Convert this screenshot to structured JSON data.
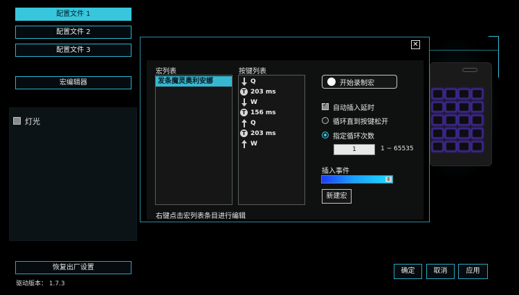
{
  "profiles": [
    {
      "label": "配置文件 1",
      "active": true
    },
    {
      "label": "配置文件 2",
      "active": false
    },
    {
      "label": "配置文件 3",
      "active": false
    }
  ],
  "macro_editor_label": "宏编辑器",
  "lighting": {
    "label": "灯光",
    "checked": false
  },
  "reset_label": "恢复出厂设置",
  "driver_version_label": "驱动版本： 1.7.3",
  "footer_buttons": {
    "ok": "确定",
    "cancel": "取消",
    "apply": "应用"
  },
  "dialog": {
    "macro_list_label": "宏列表",
    "macros": [
      "发条魔灵奥利安娜"
    ],
    "key_list_label": "按键列表",
    "key_events": [
      {
        "type": "down",
        "text": "Q"
      },
      {
        "type": "delay",
        "text": "203 ms"
      },
      {
        "type": "down",
        "text": "W"
      },
      {
        "type": "delay",
        "text": "156 ms"
      },
      {
        "type": "up",
        "text": "Q"
      },
      {
        "type": "delay",
        "text": "203 ms"
      },
      {
        "type": "up",
        "text": "W"
      }
    ],
    "record_label": "开始录制宏",
    "auto_delay_label": "自动插入延时",
    "auto_delay_checked": true,
    "loop_until_release_label": "循环直到按键松开",
    "loop_count_label": "指定循环次数",
    "loop_mode": "count",
    "loop_count_value": "1",
    "loop_range": "1 ~ 65535",
    "insert_event_label": "插入事件",
    "new_macro_label": "新建宏",
    "hint": "右键点击宏列表条目进行编辑",
    "close_symbol": "✕"
  },
  "colors": {
    "accent": "#37c6dc",
    "border": "#2aa8c2",
    "key_glow": "#5c2dff"
  }
}
